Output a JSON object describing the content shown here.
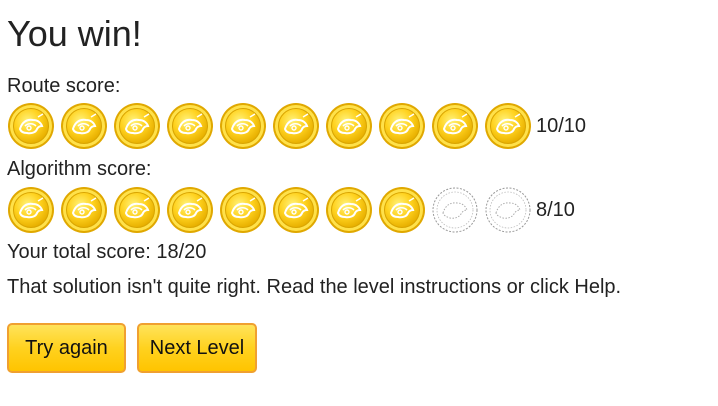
{
  "title": "You win!",
  "route": {
    "label": "Route score:",
    "earned": 10,
    "total": 10,
    "score_text": "10/10"
  },
  "algorithm": {
    "label": "Algorithm score:",
    "earned": 8,
    "total": 10,
    "score_text": "8/10"
  },
  "total_score_text": "Your total score: 18/20",
  "message": "That solution isn't quite right. Read the level instructions or click Help.",
  "buttons": {
    "try_again": "Try again",
    "next_level": "Next Level"
  },
  "colors": {
    "coin_gold": "#ffd21f",
    "coin_rim": "#e0a800",
    "coin_empty_outline": "#999999",
    "button_border": "#f0a030"
  },
  "icons": {
    "earned_coin": "gold-coin-icon",
    "missing_coin": "empty-coin-icon"
  }
}
